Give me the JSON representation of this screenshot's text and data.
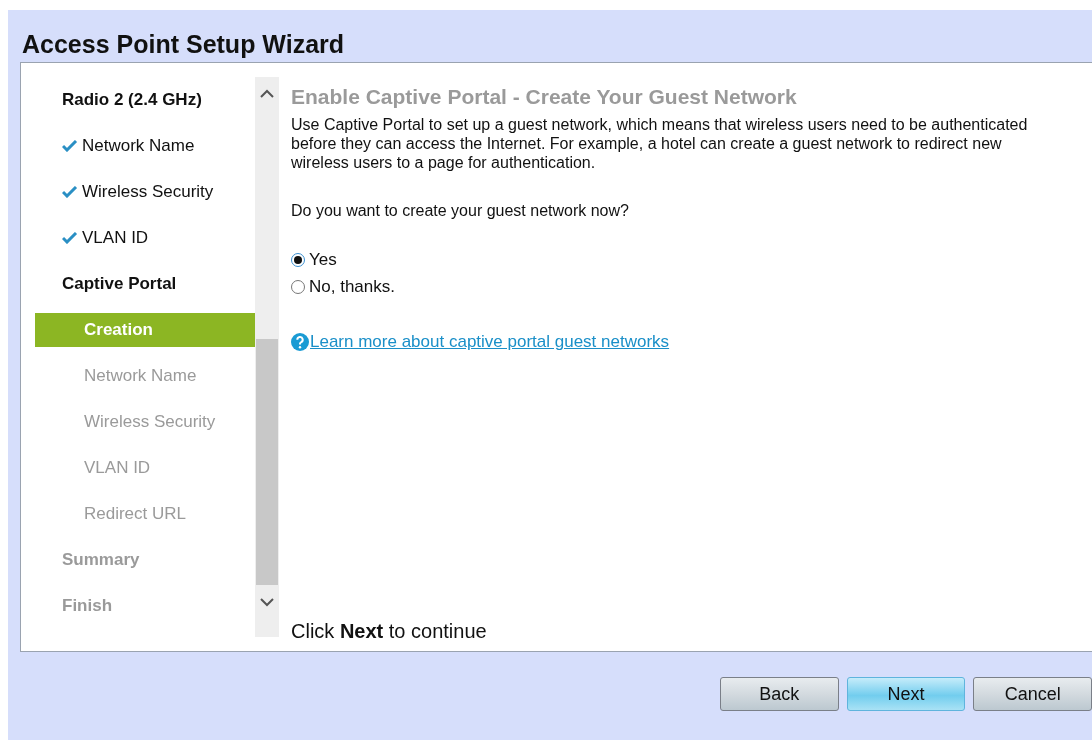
{
  "window": {
    "title": "Access Point Setup Wizard"
  },
  "steps": [
    {
      "label": "Radio 2 (2.4 GHz)",
      "selected": false,
      "disabled": false,
      "children": [
        {
          "label": "Network Name",
          "checked": true,
          "selected": false,
          "disabled": false
        },
        {
          "label": "Wireless Security",
          "checked": true,
          "selected": false,
          "disabled": false
        },
        {
          "label": "VLAN ID",
          "checked": true,
          "selected": false,
          "disabled": false
        }
      ]
    },
    {
      "label": "Captive Portal",
      "selected": false,
      "disabled": false,
      "children": [
        {
          "label": "Creation",
          "checked": false,
          "selected": true,
          "disabled": false
        },
        {
          "label": "Network Name",
          "checked": false,
          "selected": false,
          "disabled": true
        },
        {
          "label": "Wireless Security",
          "checked": false,
          "selected": false,
          "disabled": true
        },
        {
          "label": "VLAN ID",
          "checked": false,
          "selected": false,
          "disabled": true
        },
        {
          "label": "Redirect URL",
          "checked": false,
          "selected": false,
          "disabled": true
        }
      ]
    },
    {
      "label": "Summary",
      "selected": false,
      "disabled": true
    },
    {
      "label": "Finish",
      "selected": false,
      "disabled": true
    }
  ],
  "content": {
    "heading": "Enable Captive Portal - Create Your Guest Network",
    "description": "Use Captive Portal to set up a guest network, which means that wireless users need to be authenticated before they can access the Internet. For example, a hotel can create a guest network to redirect new wireless users to a page for authentication.",
    "question": "Do you want to create your guest network now?",
    "options": [
      {
        "label": "Yes",
        "selected": true
      },
      {
        "label": "No, thanks.",
        "selected": false
      }
    ],
    "help_link": "Learn more about captive portal guest networks",
    "footer": "Click **Next** to continue"
  },
  "buttons": [
    {
      "label": "Back",
      "default": false
    },
    {
      "label": "Next",
      "default": true
    },
    {
      "label": "Cancel",
      "default": false
    }
  ]
}
